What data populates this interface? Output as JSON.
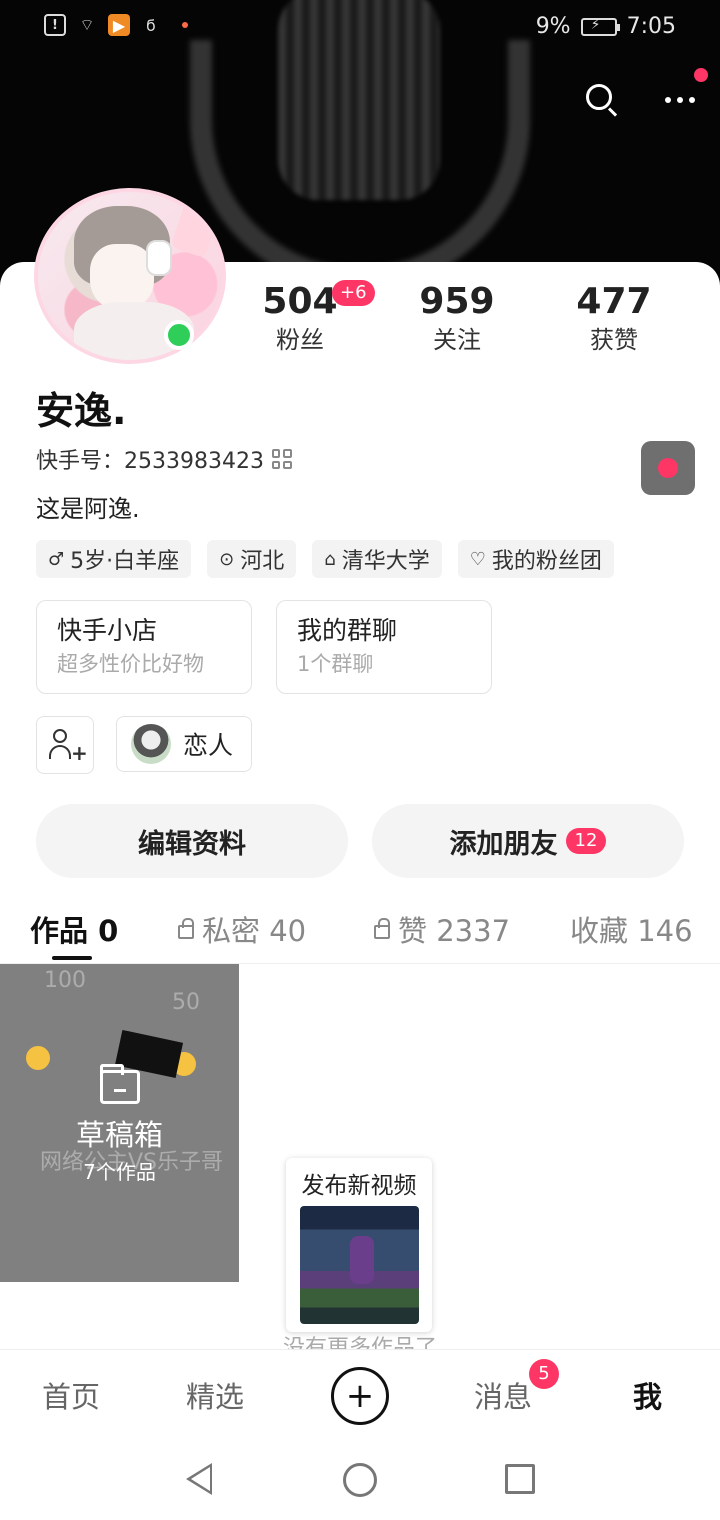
{
  "status_bar": {
    "battery": "9%",
    "time": "7:05"
  },
  "stats": [
    {
      "num": "504",
      "label": "粉丝"
    },
    {
      "num": "959",
      "label": "关注"
    },
    {
      "num": "477",
      "label": "获赞"
    }
  ],
  "stats_badge": "+6",
  "profile": {
    "name": "安逸.",
    "kid": "快手号：2533983423",
    "bio": "这是阿逸."
  },
  "tags": [
    "5岁·白羊座",
    "河北",
    "清华大学",
    "我的粉丝团"
  ],
  "cards": [
    {
      "title": "快手小店",
      "sub": "超多性价比好物"
    },
    {
      "title": "我的群聊",
      "sub": "1个群聊"
    }
  ],
  "relation_label": "恋人",
  "buttons": {
    "edit": "编辑资料",
    "add_friend": "添加朋友",
    "add_friend_badge": "12"
  },
  "tabs": [
    {
      "label": "作品 0"
    },
    {
      "label": "私密 40"
    },
    {
      "label": "赞 2337"
    },
    {
      "label": "收藏 146"
    }
  ],
  "draft": {
    "title": "草稿箱",
    "sub": "7个作品",
    "bg_texts": [
      "100",
      "50",
      "网络公主VS乐子哥"
    ]
  },
  "publish": {
    "title": "发布新视频"
  },
  "no_more": "没有更多作品了",
  "nav": {
    "home": "首页",
    "featured": "精选",
    "messages": "消息",
    "messages_badge": "5",
    "me": "我"
  },
  "colors": {
    "accent": "#fe3666",
    "online": "#2fce59"
  },
  "icons": [
    "search-icon",
    "more-icon",
    "qr-code-icon",
    "record-icon",
    "gender-male-icon",
    "location-icon",
    "school-icon",
    "fan-club-icon",
    "add-user-icon",
    "lock-icon",
    "folder-icon",
    "plus-icon"
  ]
}
